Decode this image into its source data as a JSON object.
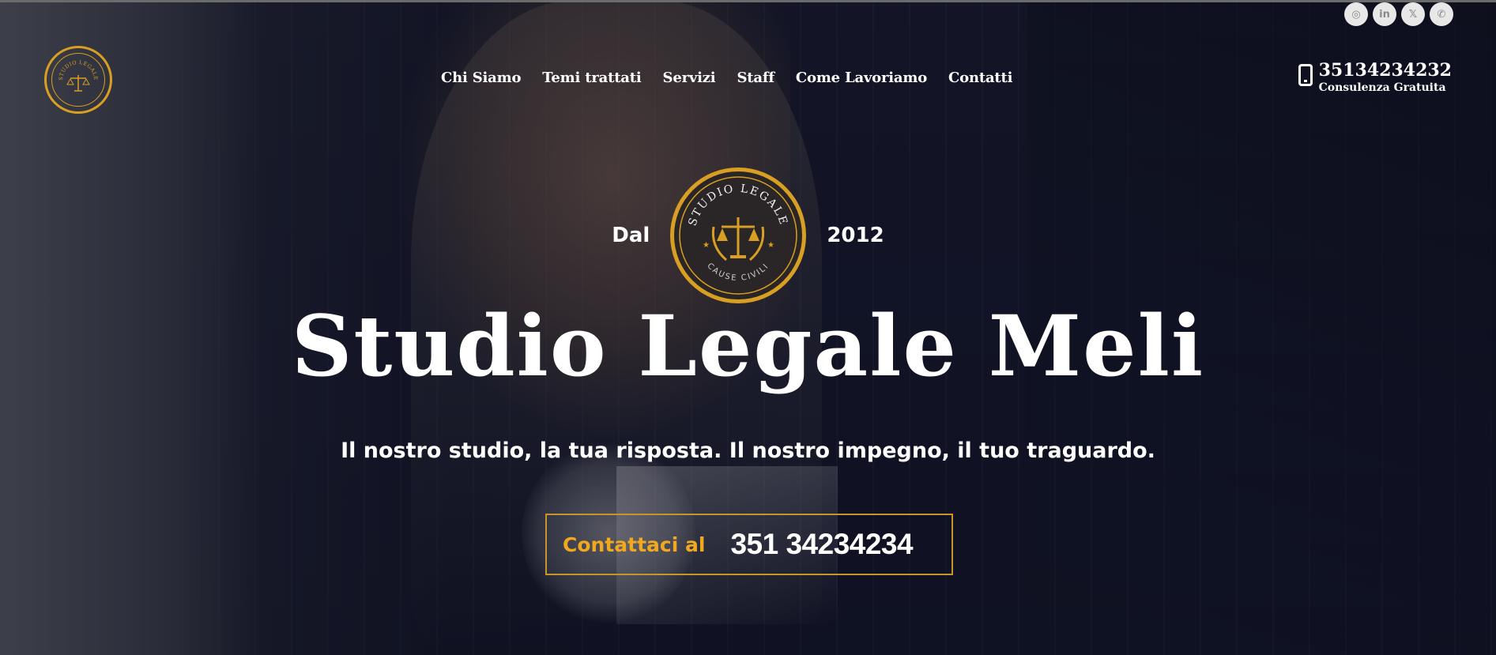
{
  "header": {
    "nav": [
      {
        "label": "Chi Siamo"
      },
      {
        "label": "Temi trattati"
      },
      {
        "label": "Servizi"
      },
      {
        "label": "Staff"
      },
      {
        "label": "Come Lavoriamo"
      },
      {
        "label": "Contatti"
      }
    ],
    "phone": "35134234232",
    "phone_sub": "Consulenza Gratuita",
    "logo_text": "STUDIO LEGALE",
    "socials": [
      {
        "icon": "instagram-icon",
        "glyph": "◎"
      },
      {
        "icon": "linkedin-icon",
        "glyph": "in"
      },
      {
        "icon": "x-icon",
        "glyph": "𝕏"
      },
      {
        "icon": "whatsapp-icon",
        "glyph": "✆"
      }
    ]
  },
  "hero": {
    "since_left": "Dal",
    "since_right": "2012",
    "seal_top": "STUDIO LEGALE",
    "seal_bottom": "CAUSE CIVILI",
    "title": "Studio Legale Meli",
    "tagline": "Il nostro studio, la tua risposta. Il nostro impegno, il tuo traguardo.",
    "cta_label": "Contattaci al",
    "cta_number": "351 34234234"
  },
  "colors": {
    "accent": "#f0a81e",
    "seal_gold": "#d99f22",
    "text": "#ffffff"
  }
}
